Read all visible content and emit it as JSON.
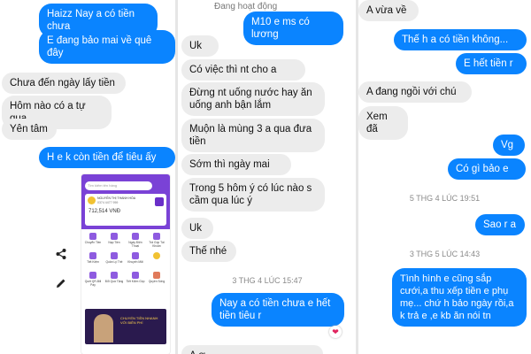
{
  "left_panel": {
    "messages": [
      {
        "dir": "out",
        "text": "Haizz Nay a có tiền chưa"
      },
      {
        "dir": "out",
        "text": "E đang bảo mai về quê đây"
      },
      {
        "dir": "in",
        "text": "Chưa đến ngày lấy tiền"
      },
      {
        "dir": "in",
        "text": "Hôm nào có a tự qua"
      },
      {
        "dir": "in",
        "text": "Yên tâm"
      },
      {
        "dir": "out",
        "text": "H e k còn tiền để tiêu ấy"
      }
    ],
    "phone_screenshot": {
      "search_placeholder": "Tìm kiếm tên hàng",
      "account_name": "NGUYỄN THỊ THANH HÒA",
      "account_number": "0374 4477 959",
      "balance": "712,514 VNĐ",
      "grid_items": [
        "Chuyển Tiền",
        "Nạp Tiền",
        "Ngày Điện Thoại",
        "Trả Góp Tài Khoản",
        "Tiết Kiệm",
        "Quản Lý Thẻ",
        "Khuyến Mãi",
        "",
        "Quét QR-Bill Pay",
        "Đổi Quà Tặng",
        "Tiết Kiệm Góp",
        "Quyền Sống"
      ],
      "banner_text": "CHUYỂN TIỀN NHANH VỚI BIÊN PHÍ",
      "brand_color": "#7a42d6"
    },
    "icons": [
      "share-icon",
      "edit-icon"
    ]
  },
  "middle_panel": {
    "status": "Đang hoạt động",
    "messages": [
      {
        "dir": "out",
        "text": "M10 e ms có lương"
      },
      {
        "dir": "in",
        "text": "Uk"
      },
      {
        "dir": "in",
        "text": "Có việc thì nt cho a"
      },
      {
        "dir": "in",
        "text": "Đừng nt uống nước hay ăn uống anh bận lắm"
      },
      {
        "dir": "in",
        "text": "Muộn là mùng 3 a qua đưa tiền"
      },
      {
        "dir": "in",
        "text": "Sớm thì ngày mai"
      },
      {
        "dir": "in",
        "text": "Trong 5 hôm ý có lúc nào s cầm qua lúc ý"
      },
      {
        "dir": "in",
        "text": "Uk"
      },
      {
        "dir": "in",
        "text": "Thế nhé"
      },
      {
        "dir": "out",
        "text": "Nay a có tiền chưa e hết tiền tiêu r"
      },
      {
        "dir": "in",
        "text": "A ơ... ..."
      }
    ],
    "timestamp": "3 THG 4 LÚC 15:47",
    "reaction": "❤"
  },
  "right_panel": {
    "messages": [
      {
        "dir": "in",
        "text": "A vừa về"
      },
      {
        "dir": "out",
        "text": "Thế h a có tiền không..."
      },
      {
        "dir": "out",
        "text": "E hết tiền r"
      },
      {
        "dir": "in",
        "text": "A đang ngồi với chú"
      },
      {
        "dir": "in",
        "text": "Xem đã"
      },
      {
        "dir": "out",
        "text": "Vg"
      },
      {
        "dir": "out",
        "text": "Có gì bảo e"
      },
      {
        "dir": "out",
        "text": "Sao r a"
      },
      {
        "dir": "out",
        "text": "Tình hình e cũng sắp cưới,a thu xếp tiền e phụ mẹ... chứ h bảo ngày rồi,a k trả e ,e kb ăn nói tn"
      }
    ],
    "timestamps": [
      "5 THG 4 LÚC 19:51",
      "3 THG 5 LÚC 14:43"
    ]
  },
  "colors": {
    "outgoing": "#0a84ff",
    "incoming": "#ececec",
    "online": "#31a24c"
  }
}
